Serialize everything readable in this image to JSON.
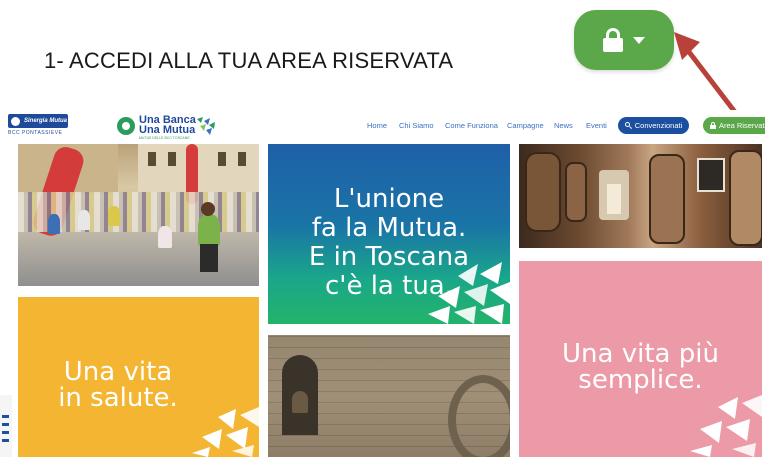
{
  "instruction": {
    "text": "1- ACCEDI ALLA TUA AREA RISERVATA"
  },
  "highlight_button": {
    "icon": "lock-icon",
    "caret": "caret-down-icon",
    "color": "#5aa84a"
  },
  "site": {
    "logo_left": {
      "brand": "Sinergia Mutua",
      "sub": "BCC PONTASSIEVE"
    },
    "logo_mid": {
      "line1": "Una Banca",
      "line2": "Una Mutua",
      "line3": "MUTUE DELLE BCC TOSCANE"
    },
    "nav": [
      "Home",
      "Chi Siamo",
      "Come Funziona",
      "Campagne",
      "News",
      "Eventi"
    ],
    "convenzionati_button": "Convenzionati",
    "area_riservata_button": "Area Riservata",
    "accent_blue": "#1c4fa0",
    "accent_green": "#5aa84a"
  },
  "tiles": {
    "green": {
      "lines": [
        "L'unione",
        "fa la Mutua.",
        "E in Toscana",
        "c'è la tua."
      ]
    },
    "orange": {
      "lines": [
        "Una vita",
        "in salute."
      ]
    },
    "pink": {
      "lines": [
        "Una vita più",
        "semplice."
      ]
    }
  }
}
